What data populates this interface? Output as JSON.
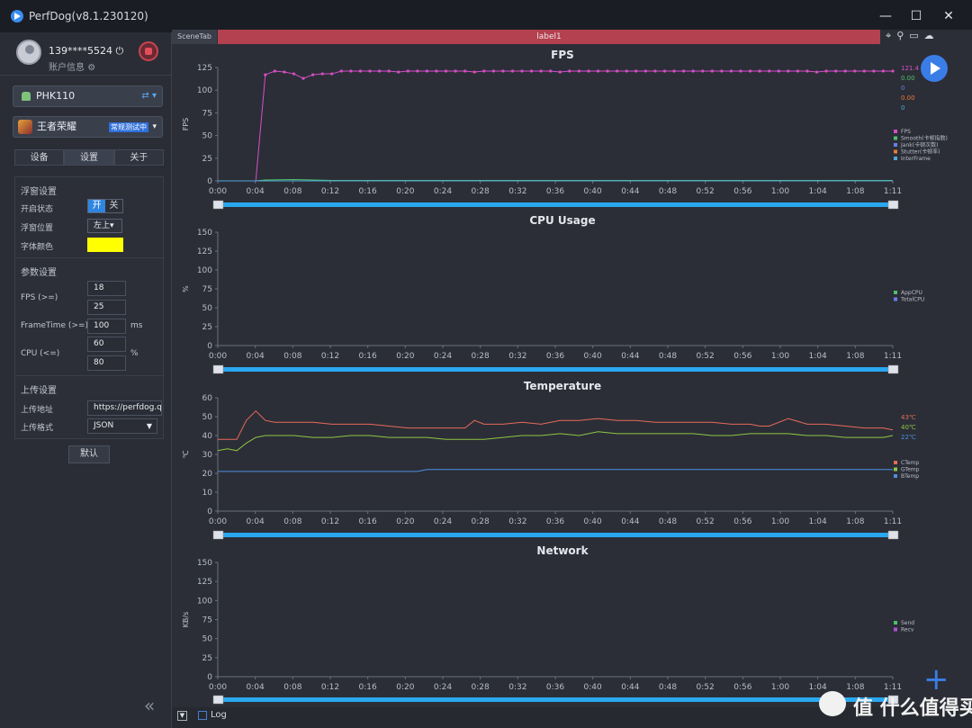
{
  "window": {
    "title": "PerfDog(v8.1.230120)"
  },
  "user": {
    "name": "139****5524",
    "info": "账户信息"
  },
  "device": {
    "name": "PHK110"
  },
  "app": {
    "name": "王者荣耀",
    "badge": "常规测试中"
  },
  "tabs": [
    "设备",
    "设置",
    "关于"
  ],
  "settings": {
    "float_title": "浮窗设置",
    "enable_label": "开启状态",
    "toggle_on": "开",
    "toggle_off": "关",
    "position_label": "浮窗位置",
    "position_value": "左上",
    "font_color_label": "字体颜色",
    "font_color": "#ffff00",
    "param_title": "参数设置",
    "fps_label": "FPS (>=)",
    "fps_values": [
      "18",
      "25"
    ],
    "frametime_label": "FrameTime (>=)",
    "frametime_value": "100",
    "frametime_unit": "ms",
    "cpu_label": "CPU (<=)",
    "cpu_values": [
      "60",
      "80"
    ],
    "cpu_unit": "%",
    "upload_title": "上传设置",
    "upload_url_label": "上传地址",
    "upload_url": "https://perfdog.q",
    "upload_format_label": "上传格式",
    "upload_format": "JSON",
    "default_button": "默认"
  },
  "toolbar": {
    "scene_tab": "SceneTab",
    "label": "label1"
  },
  "bottom": {
    "log_label": "Log"
  },
  "watermark": "值 什么值得买",
  "accent": "#3b7de6",
  "chart_data": [
    {
      "type": "line",
      "title": "FPS",
      "ylabel": "FPS",
      "ylim": [
        0,
        125
      ],
      "yticks": [
        0,
        25,
        50,
        75,
        100,
        125
      ],
      "xlabels": [
        "0:00",
        "0:04",
        "0:08",
        "0:12",
        "0:16",
        "0:20",
        "0:24",
        "0:28",
        "0:32",
        "0:36",
        "0:40",
        "0:44",
        "0:48",
        "0:52",
        "0:56",
        "1:00",
        "1:04",
        "1:08",
        "1:11"
      ],
      "xmax": 71,
      "series": [
        {
          "name": "FPS",
          "color": "#d64fc4",
          "marker": true,
          "x": [
            0,
            1,
            2,
            3,
            4,
            5,
            6,
            7,
            8,
            9,
            10,
            11,
            12,
            13,
            14,
            15,
            16,
            17,
            18,
            19,
            20,
            21,
            22,
            23,
            24,
            25,
            26,
            27,
            28,
            29,
            30,
            31,
            32,
            33,
            34,
            35,
            36,
            37,
            38,
            39,
            40,
            41,
            42,
            43,
            44,
            45,
            46,
            47,
            48,
            49,
            50,
            51,
            52,
            53,
            54,
            55,
            56,
            57,
            58,
            59,
            60,
            61,
            62,
            63,
            64,
            65,
            66,
            67,
            68,
            69,
            70,
            71
          ],
          "values": [
            0,
            0,
            0,
            0,
            0,
            117,
            121,
            120,
            118,
            113,
            117,
            118,
            118,
            121,
            121,
            121,
            121,
            121,
            121,
            120,
            121,
            121,
            121,
            121,
            121,
            121,
            121,
            120,
            121,
            121,
            121,
            121,
            121,
            121,
            121,
            121,
            120,
            121,
            121,
            121,
            121,
            121,
            121,
            121,
            121,
            121,
            121,
            121,
            121,
            121,
            121,
            121,
            121,
            121,
            121,
            121,
            121,
            121,
            121,
            121,
            121,
            121,
            121,
            120,
            121,
            121,
            121,
            121,
            121,
            121,
            121,
            121
          ]
        },
        {
          "name": "Smooth(卡顿指数)",
          "color": "#4fbf6c",
          "marker": false,
          "x": [
            0,
            4,
            5,
            8,
            10,
            12,
            20,
            30,
            40,
            50,
            60,
            71
          ],
          "values": [
            0,
            0,
            1,
            1.5,
            1,
            0.5,
            0.5,
            0.5,
            0.5,
            0.5,
            0.5,
            0.5
          ]
        },
        {
          "name": "Jank(卡顿次数)",
          "color": "#6a7de8",
          "marker": false,
          "x": [
            0,
            71
          ],
          "values": [
            0,
            0
          ]
        },
        {
          "name": "Stutter(卡顿率)",
          "color": "#ea7a3a",
          "marker": false,
          "x": [
            0,
            71
          ],
          "values": [
            0,
            0
          ]
        },
        {
          "name": "InterFrame",
          "color": "#52a7d8",
          "marker": false,
          "x": [
            0,
            71
          ],
          "values": [
            0,
            0
          ]
        }
      ],
      "current_values": [
        {
          "text": "121.4",
          "color": "#d64fc4"
        },
        {
          "text": "0.00",
          "color": "#4fbf6c"
        },
        {
          "text": "0",
          "color": "#6a7de8"
        },
        {
          "text": "0.00",
          "color": "#ea7a3a"
        },
        {
          "text": "0",
          "color": "#52a7d8"
        }
      ],
      "legend": "right"
    },
    {
      "type": "line",
      "title": "CPU Usage",
      "ylabel": "%",
      "ylim": [
        0,
        150
      ],
      "yticks": [
        0,
        25,
        50,
        75,
        100,
        125,
        150
      ],
      "xlabels": [
        "0:00",
        "0:04",
        "0:08",
        "0:12",
        "0:16",
        "0:20",
        "0:24",
        "0:28",
        "0:32",
        "0:36",
        "0:40",
        "0:44",
        "0:48",
        "0:52",
        "0:56",
        "1:00",
        "1:04",
        "1:08",
        "1:11"
      ],
      "xmax": 71,
      "series": [
        {
          "name": "AppCPU",
          "color": "#4fbf6c",
          "marker": false,
          "x": [],
          "values": []
        },
        {
          "name": "TotalCPU",
          "color": "#6a7de8",
          "marker": false,
          "x": [],
          "values": []
        }
      ],
      "current_values": [],
      "legend": "right"
    },
    {
      "type": "line",
      "title": "Temperature",
      "ylabel": "℃",
      "ylim": [
        0,
        60
      ],
      "yticks": [
        0,
        10,
        20,
        30,
        40,
        50,
        60
      ],
      "xlabels": [
        "0:00",
        "0:04",
        "0:08",
        "0:12",
        "0:16",
        "0:20",
        "0:24",
        "0:28",
        "0:32",
        "0:36",
        "0:40",
        "0:44",
        "0:48",
        "0:52",
        "0:56",
        "1:00",
        "1:04",
        "1:08",
        "1:11"
      ],
      "xmax": 71,
      "series": [
        {
          "name": "CTemp",
          "color": "#e8695a",
          "marker": false,
          "x": [
            0,
            1,
            2,
            3,
            4,
            5,
            6,
            7,
            8,
            10,
            12,
            14,
            16,
            18,
            20,
            22,
            24,
            26,
            27,
            28,
            30,
            32,
            34,
            36,
            38,
            40,
            42,
            44,
            46,
            48,
            50,
            52,
            54,
            56,
            57,
            58,
            60,
            62,
            64,
            66,
            68,
            70,
            71
          ],
          "values": [
            38,
            38,
            38,
            48,
            53,
            48,
            47,
            47,
            47,
            47,
            46,
            46,
            46,
            45,
            44,
            44,
            44,
            44,
            48,
            46,
            46,
            47,
            46,
            48,
            48,
            49,
            48,
            48,
            47,
            47,
            47,
            47,
            46,
            46,
            45,
            45,
            49,
            46,
            46,
            45,
            44,
            44,
            43
          ]
        },
        {
          "name": "GTemp",
          "color": "#8fc640",
          "marker": false,
          "x": [
            0,
            1,
            2,
            3,
            4,
            5,
            6,
            8,
            10,
            12,
            14,
            16,
            18,
            20,
            22,
            24,
            26,
            28,
            30,
            32,
            34,
            36,
            38,
            40,
            42,
            44,
            46,
            48,
            50,
            52,
            54,
            56,
            58,
            60,
            62,
            64,
            66,
            68,
            70,
            71
          ],
          "values": [
            32,
            33,
            32,
            36,
            39,
            40,
            40,
            40,
            39,
            39,
            40,
            40,
            39,
            39,
            39,
            38,
            38,
            38,
            39,
            40,
            40,
            41,
            40,
            42,
            41,
            41,
            41,
            41,
            41,
            40,
            40,
            41,
            41,
            41,
            40,
            40,
            39,
            39,
            39,
            40
          ]
        },
        {
          "name": "BTemp",
          "color": "#4d8fe0",
          "marker": false,
          "x": [
            0,
            20,
            21,
            22,
            71
          ],
          "values": [
            21,
            21,
            21,
            22,
            22
          ]
        }
      ],
      "current_values": [
        {
          "text": "43℃",
          "color": "#e8695a"
        },
        {
          "text": "40℃",
          "color": "#8fc640"
        },
        {
          "text": "22℃",
          "color": "#4d8fe0"
        }
      ],
      "legend": "right"
    },
    {
      "type": "line",
      "title": "Network",
      "ylabel": "KB/s",
      "ylim": [
        0,
        150
      ],
      "yticks": [
        0,
        25,
        50,
        75,
        100,
        125,
        150
      ],
      "xlabels": [
        "0:00",
        "0:04",
        "0:08",
        "0:12",
        "0:16",
        "0:20",
        "0:24",
        "0:28",
        "0:32",
        "0:36",
        "0:40",
        "0:44",
        "0:48",
        "0:52",
        "0:56",
        "1:00",
        "1:04",
        "1:08",
        "1:11"
      ],
      "xmax": 71,
      "series": [
        {
          "name": "Send",
          "color": "#4fbf6c",
          "marker": false,
          "x": [],
          "values": []
        },
        {
          "name": "Recv",
          "color": "#b04fd6",
          "marker": false,
          "x": [],
          "values": []
        }
      ],
      "current_values": [],
      "legend": "right"
    }
  ]
}
